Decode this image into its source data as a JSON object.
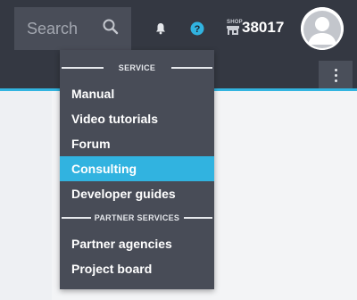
{
  "header": {
    "search": {
      "label": "Search"
    },
    "credits": "38017",
    "shop_label": "SHOP"
  },
  "menu": {
    "sections": [
      {
        "title": "SERVICE",
        "items": [
          "Manual",
          "Video tutorials",
          "Forum",
          "Consulting",
          "Developer guides"
        ]
      },
      {
        "title": "PARTNER SERVICES",
        "items": [
          "Partner agencies",
          "Project board"
        ]
      }
    ],
    "active_item": "Consulting"
  },
  "colors": {
    "topbar": "#343842",
    "menu_bg": "#484c57",
    "accent": "#31b3e0",
    "help_icon": "#31b3e0"
  }
}
